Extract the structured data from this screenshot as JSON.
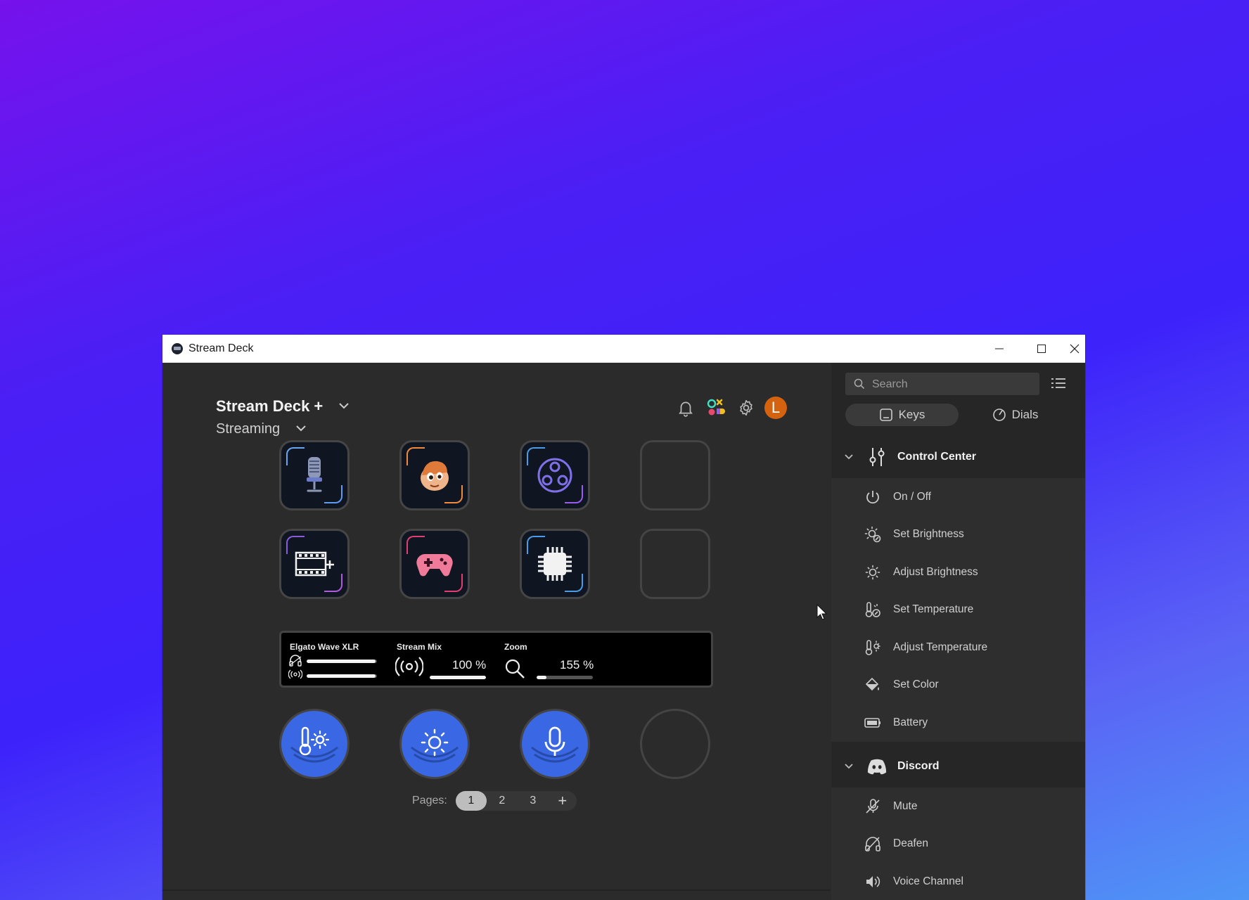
{
  "window": {
    "title": "Stream Deck"
  },
  "header": {
    "device_name": "Stream Deck +",
    "profile_name": "Streaming",
    "avatar_letter": "L"
  },
  "lcd": {
    "wave": {
      "label": "Elgato Wave XLR",
      "headphone_level": 0.98,
      "mic_level": 0.98
    },
    "stream_mix": {
      "label": "Stream Mix",
      "value": "100 %",
      "level": 1.0
    },
    "zoom": {
      "label": "Zoom",
      "value": "155 %",
      "level": 0.18
    }
  },
  "pages": {
    "label": "Pages:",
    "items": [
      "1",
      "2",
      "3"
    ],
    "active": "1",
    "add_label": "+"
  },
  "sidebar": {
    "search_placeholder": "Search",
    "tabs": {
      "keys": "Keys",
      "dials": "Dials"
    },
    "control_center": {
      "title": "Control Center",
      "items": [
        "On / Off",
        "Set Brightness",
        "Adjust Brightness",
        "Set Temperature",
        "Adjust Temperature",
        "Set Color",
        "Battery"
      ]
    },
    "discord": {
      "title": "Discord",
      "items": [
        "Mute",
        "Deafen",
        "Voice Channel"
      ]
    }
  },
  "colors": {
    "accent_blue": "#3a67e3",
    "avatar_orange": "#d4620e",
    "main_bg": "#2b2b2b",
    "sidebar_bg": "#262626"
  }
}
